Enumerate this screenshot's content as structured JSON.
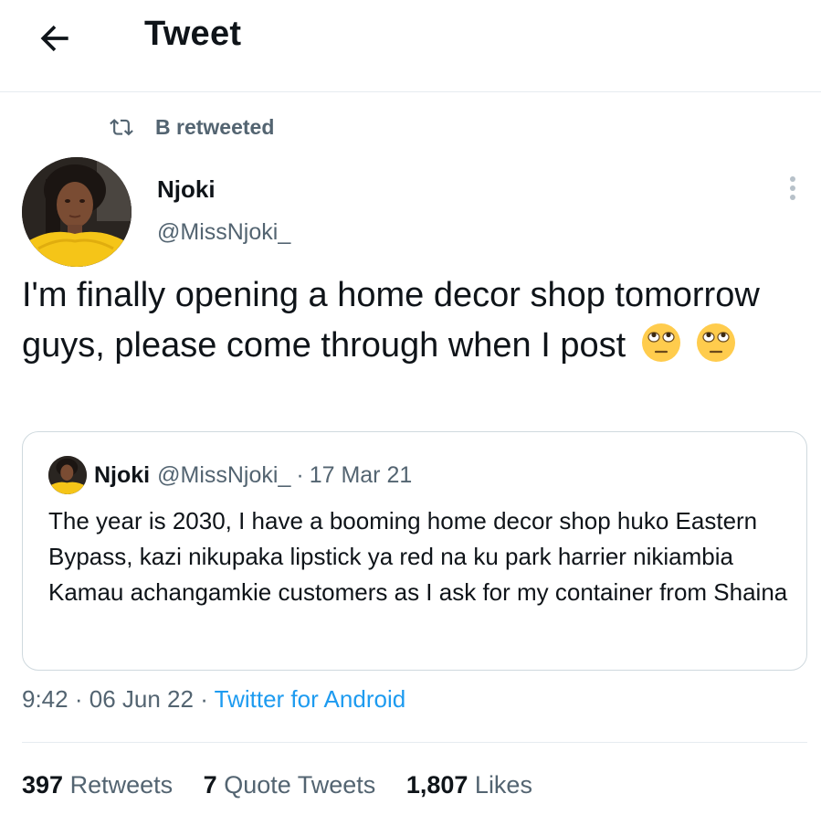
{
  "header": {
    "title": "Tweet",
    "back_icon": "arrow-left-icon"
  },
  "retweet_context": {
    "text": "B retweeted",
    "icon": "retweet-icon"
  },
  "author": {
    "name": "Njoki",
    "handle": "@MissNjoki_"
  },
  "tweet": {
    "text": "I'm finally opening a home decor shop tomorrow guys, please come through when I post",
    "emojis": [
      "face-with-rolling-eyes",
      "face-with-rolling-eyes"
    ]
  },
  "quoted_tweet": {
    "name": "Njoki",
    "handle": "@MissNjoki_",
    "separator": "·",
    "date": "17 Mar 21",
    "text": "The year is 2030, I have a booming home decor shop huko Eastern Bypass, kazi nikupaka lipstick ya red na ku park harrier nikiambia Kamau achangamkie customers as I ask for my container from Shaina"
  },
  "meta": {
    "time": "9:42",
    "sep1": "·",
    "date": "06 Jun 22",
    "sep2": "·",
    "source": "Twitter for Android"
  },
  "stats": {
    "retweets_count": "397",
    "retweets_label": "Retweets",
    "quotes_count": "7",
    "quotes_label": "Quote Tweets",
    "likes_count": "1,807",
    "likes_label": "Likes"
  },
  "colors": {
    "accent": "#1d9bf0",
    "secondary_text": "#536471",
    "primary_text": "#0f1419",
    "avatar_shirt": "#f5c518"
  }
}
